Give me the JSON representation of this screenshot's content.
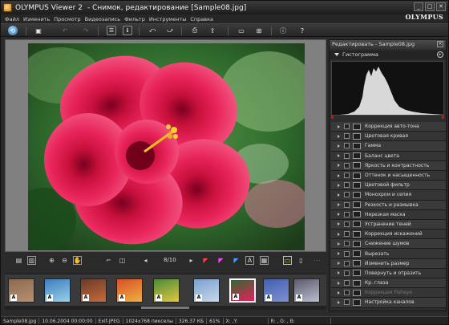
{
  "window": {
    "app_title": "OLYMPUS Viewer 2",
    "doc_title": "-  Снимок, редактирование [Sample08.jpg]",
    "brand_logo": "OLYMPUS",
    "controls": {
      "minimize": "_",
      "maximize": "□",
      "close": "✕"
    }
  },
  "menu": [
    "Файл",
    "Изменить",
    "Просмотр",
    "Видеозапись",
    "Фильтр",
    "Инструменты",
    "Справка"
  ],
  "toolbar": {
    "icons": [
      "back-icon",
      "save-icon",
      "undo-icon",
      "redo-icon",
      "view-single-icon",
      "info-icon",
      "rotate-left-icon",
      "rotate-right-icon",
      "print-icon",
      "share-icon",
      "slideshow-icon",
      "compare-icon",
      "info-circle-icon",
      "help-icon"
    ]
  },
  "image_bar": {
    "counter": "8/10",
    "icons": [
      "film-icon",
      "film2-icon",
      "zoom-in-icon",
      "zoom-out-icon",
      "hand-icon",
      "crop-icon",
      "shape-icon",
      "prev-icon",
      "rgb-icon",
      "rgb2-icon",
      "rgb3-icon",
      "rgb4-icon",
      "a-mark-icon",
      "grid-icon",
      "single-view-icon",
      "dual-view-icon",
      "extra-icon"
    ]
  },
  "filmstrip": {
    "badge": "A",
    "thumbs": [
      {
        "colors": [
          "#8a6a50",
          "#b89070"
        ]
      },
      {
        "colors": [
          "#3c7ec0",
          "#9ad0e8"
        ]
      },
      {
        "colors": [
          "#6a3b2a",
          "#c86a3a"
        ]
      },
      {
        "colors": [
          "#d8502a",
          "#f0b040"
        ]
      },
      {
        "colors": [
          "#4a8a3a",
          "#e0c840"
        ]
      },
      {
        "colors": [
          "#7aa0d0",
          "#c8d8e8"
        ]
      },
      {
        "colors": [
          "#2f6a30",
          "#e8205a"
        ],
        "selected": true
      },
      {
        "colors": [
          "#4060b0",
          "#8090d0"
        ]
      },
      {
        "colors": [
          "#5a5a6a",
          "#b8c0d0"
        ]
      }
    ]
  },
  "panel": {
    "title": "Редактировать - Sample08.jpg",
    "histogram_label": "Гистограмма",
    "adjustments": [
      {
        "label": "Коррекция авто-тона",
        "icon": "auto-tone-icon"
      },
      {
        "label": "Цветовая кривая",
        "icon": "curve-icon"
      },
      {
        "label": "Гамма",
        "icon": "gamma-icon"
      },
      {
        "label": "Баланс цвета",
        "icon": "balance-icon"
      },
      {
        "label": "Яркость и контрастность",
        "icon": "brightness-icon"
      },
      {
        "label": "Оттенок и насыщенность",
        "icon": "hue-icon"
      },
      {
        "label": "Цветовой фильтр",
        "icon": "color-filter-icon"
      },
      {
        "label": "Монохром и сепия",
        "icon": "mono-icon"
      },
      {
        "label": "Резкость и размывка",
        "icon": "sharpness-icon"
      },
      {
        "label": "Нерезкая маска",
        "icon": "unsharp-icon"
      },
      {
        "label": "Устранение теней",
        "icon": "shadow-icon"
      },
      {
        "label": "Коррекция искажений",
        "icon": "distortion-icon"
      },
      {
        "label": "Снижение шумов",
        "icon": "noise-icon"
      },
      {
        "label": "Вырезать",
        "icon": "cut-icon"
      },
      {
        "label": "Изменить размер",
        "icon": "resize-icon"
      },
      {
        "label": "Повернуть и отразить",
        "icon": "rotate-icon"
      },
      {
        "label": "Кр. глаза",
        "icon": "red-eye-icon"
      },
      {
        "label": "Коррекция Fisheye",
        "icon": "fisheye-icon",
        "dim": true
      },
      {
        "label": "Настройка каналов",
        "icon": "channels-icon"
      }
    ]
  },
  "status": {
    "filename": "Sample08.jpg",
    "datetime": "10.06.2004 00:00:00",
    "format": "Exif-JPEG",
    "dimensions": "1024x768 пикселы",
    "filesize": "326.37 КБ",
    "zoom": "61%",
    "coords": "X: ,Y:",
    "rgb": "R: , G: , B:"
  },
  "colors": {
    "flower": "#e8245a",
    "leaf": "#2f6a2c",
    "accent_yellow": "#e4d400"
  }
}
